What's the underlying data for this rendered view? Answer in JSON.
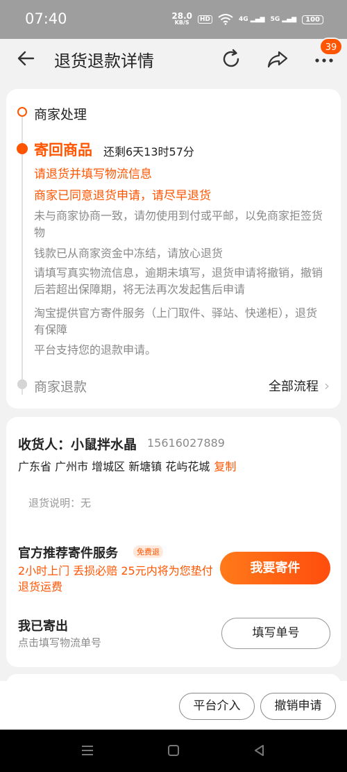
{
  "status_bar": {
    "time": "07:40",
    "net_speed_value": "28.0",
    "net_speed_unit": "KB/S",
    "hd": "HD",
    "signal1": "4G",
    "signal2": "5G",
    "battery": "100"
  },
  "header": {
    "title": "退货退款详情",
    "more_badge": "39"
  },
  "progress": {
    "step1": "商家处理",
    "step2": "寄回商品",
    "remaining": "还剩6天13时57分",
    "orange_line1": "请退货并填写物流信息",
    "orange_line2": "商家已同意退货申请，请尽早退货",
    "gray1": "未与商家协商一致，请勿使用到付或平邮，以免商家拒签货物",
    "gray2": "钱款已从商家资金中冻结，请放心退货",
    "gray3": "请填写真实物流信息，逾期未填写，退货申请将撤销，撤销后若超出保障期，将无法再次发起售后申请",
    "gray4": "淘宝提供官方寄件服务（上门取件、驿站、快递柜），退货有保障",
    "gray5": "平台支持您的退款申请。",
    "step3": "商家退款",
    "all_flow": "全部流程"
  },
  "receiver": {
    "label": "收货人：",
    "name": "小鼠拌水晶",
    "phone": "15616027889",
    "address": "广东省 广州市 增城区 新塘镇  花屿花城",
    "copy": "复制",
    "note": "退货说明：无"
  },
  "service": {
    "title": "官方推荐寄件服务",
    "tag": "免费退",
    "desc": "2小时上门 丢损必赔 25元内将为您垫付退货运费",
    "button": "我要寄件"
  },
  "sent": {
    "title": "我已寄出",
    "subtitle": "点击填写物流单号",
    "button": "填写单号"
  },
  "bottom": {
    "platform": "平台介入",
    "cancel": "撤销申请"
  },
  "colors": {
    "accent": "#ff5500",
    "statusbar": "#9e9e9e"
  }
}
